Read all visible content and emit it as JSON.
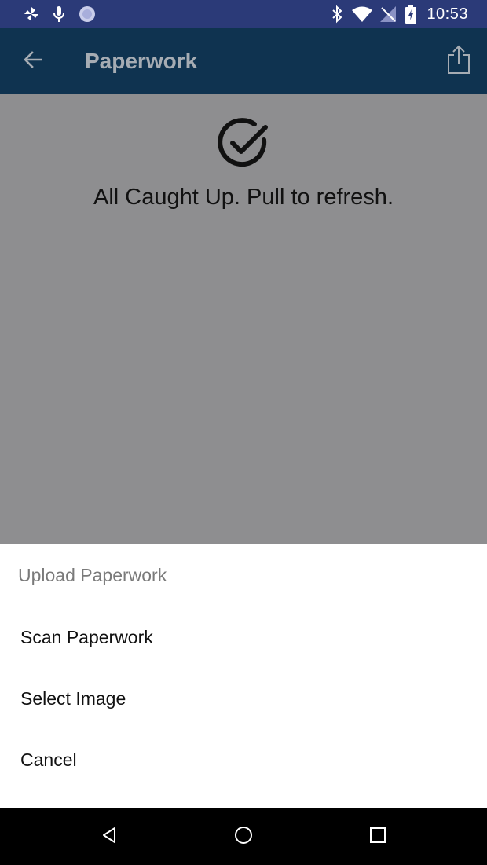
{
  "status_bar": {
    "time": "10:53",
    "left_icons": [
      "pinwheel-icon",
      "microphone-icon",
      "circle-dots-icon"
    ],
    "right_icons": [
      "bluetooth-icon",
      "wifi-icon",
      "no-signal-icon",
      "battery-icon"
    ]
  },
  "app_bar": {
    "title": "Paperwork",
    "back_icon": "arrow-left-icon",
    "share_icon": "share-icon"
  },
  "content": {
    "icon": "check-circle-icon",
    "message": "All Caught Up. Pull to refresh."
  },
  "bottom_sheet": {
    "title": "Upload Paperwork",
    "options": [
      "Scan Paperwork",
      "Select Image",
      "Cancel"
    ]
  },
  "nav_bar": {
    "buttons": [
      "back-triangle-icon",
      "home-circle-icon",
      "recents-square-icon"
    ]
  },
  "colors": {
    "status_bar": "#2b3a78",
    "app_bar": "#0f3350",
    "scrim": "#8e8e90",
    "sheet": "#ffffff"
  }
}
